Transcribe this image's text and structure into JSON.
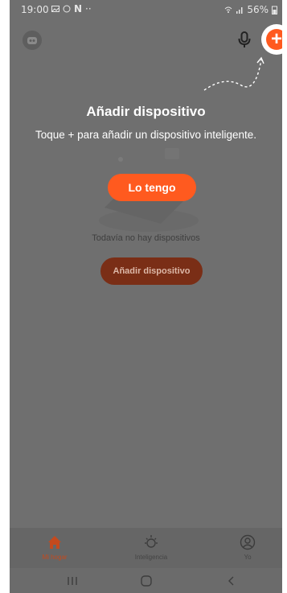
{
  "status_bar": {
    "time": "19:00",
    "notif_letter": "N",
    "dots": "··",
    "battery": "56%"
  },
  "guide": {
    "title": "Añadir dispositivo",
    "subtitle": "Toque + para añadir un dispositivo inteligente.",
    "confirm_label": "Lo tengo"
  },
  "empty_state": {
    "message": "Todavía no hay dispositivos",
    "add_label": "Añadir dispositivo"
  },
  "bottom_nav": {
    "items": [
      {
        "label": "Mi hogar",
        "icon": "home-icon",
        "active": true
      },
      {
        "label": "Inteligencia",
        "icon": "sun-icon",
        "active": false
      },
      {
        "label": "Yo",
        "icon": "profile-icon",
        "active": false
      }
    ]
  },
  "colors": {
    "accent": "#ff5a1f",
    "overlay": "#6f6f6f"
  }
}
